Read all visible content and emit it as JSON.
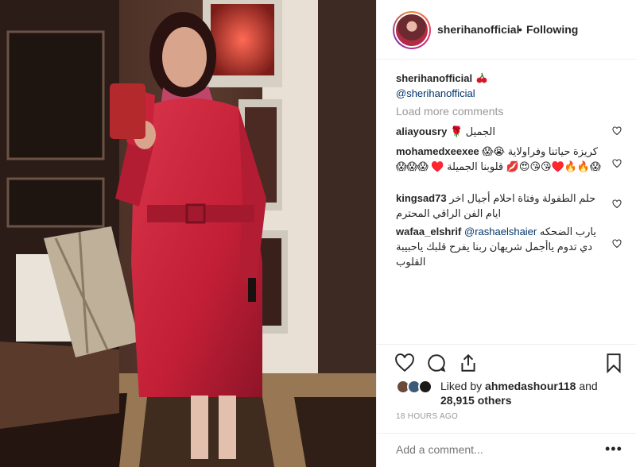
{
  "post": {
    "image_alt": "Woman in red trench coat",
    "header": {
      "username": "sherihanofficial",
      "separator": "•",
      "follow_status": "Following"
    },
    "caption": {
      "username": "sherihanofficial",
      "emoji": "cherries",
      "mention": "@sherihanofficial"
    },
    "load_more": "Load more comments",
    "comments": [
      {
        "username": "aliayousry",
        "text": "الجميل 🌹"
      },
      {
        "username": "mohamedxeexee",
        "text": "كريزة حياتنا وفراولاية 😭😱😱🔥🔥♥️😘😘😍💋 قلوبنا الجميلة ♥️ 😱😱😱"
      },
      {
        "username": "kingsad73",
        "text": "حلم الطفولة وفتاة احلام أجيال اخر ايام الفن الراقي المحترم"
      },
      {
        "username": "wafaa_elshrif",
        "mention": "@rashaelshaier",
        "text": "يارب الضحكه دي تدوم ياأجمل شريهان ربنا يفرح قلبك ياحبيبة القلوب"
      }
    ],
    "likes": {
      "prefix": "Liked by",
      "user": "ahmedashour118",
      "conj": "and",
      "others": "28,915 others"
    },
    "time_ago": "18 HOURS AGO",
    "add_comment_placeholder": "Add a comment...",
    "more": "•••"
  },
  "colors": {
    "text": "#262626",
    "muted": "#999999",
    "link": "#003569",
    "divider": "#efefef",
    "coat": "#c8233b"
  },
  "icons": [
    "heart-icon",
    "comment-icon",
    "share-icon",
    "bookmark-icon",
    "cherry-icon",
    "small-heart-icon"
  ]
}
